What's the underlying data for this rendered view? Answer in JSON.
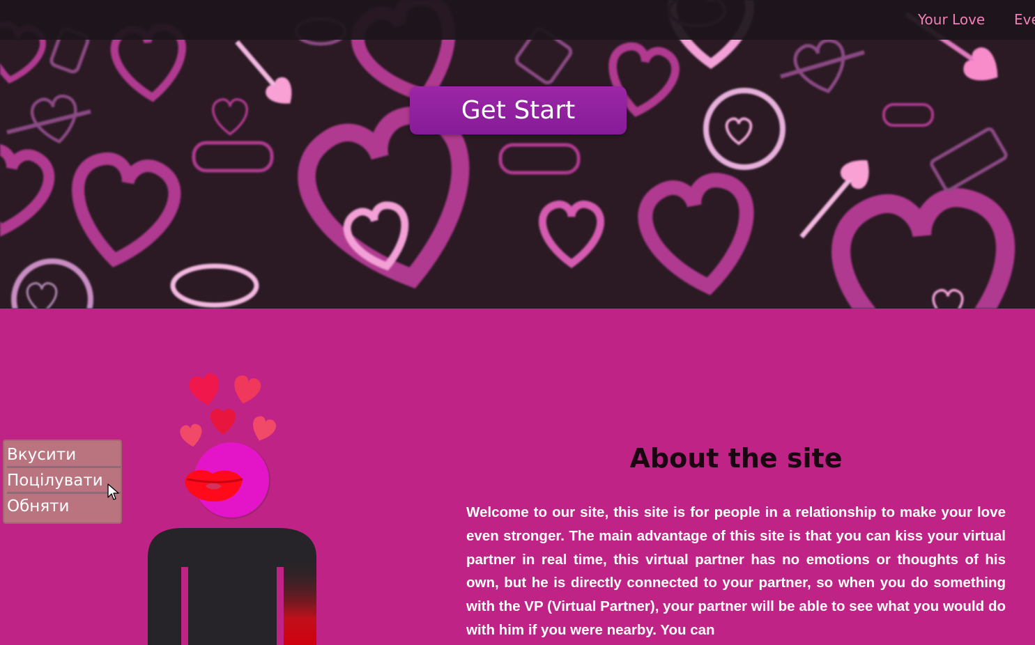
{
  "nav": {
    "links": [
      "Your Love",
      "Eve"
    ]
  },
  "hero": {
    "cta_label": "Get Start"
  },
  "context_menu": {
    "items": [
      "Вкусити",
      "Поцілувати",
      "Обняти"
    ]
  },
  "about": {
    "title": "About the site",
    "text": "Welcome to our site, this site is for people in a relationship to make your love even stronger. The main advantage of this site is that you can kiss your virtual partner in real time, this virtual partner has no emotions or thoughts of his own, but he is directly connected to your partner, so when you do something with the VP (Virtual Partner), your partner will be able to see what you would do with him if you were nearby. You can"
  },
  "colors": {
    "hero_bg": "#2b1a24",
    "section_bg": "#c02386",
    "nav_link": "#f080b8",
    "button": "#8e1f9c"
  }
}
